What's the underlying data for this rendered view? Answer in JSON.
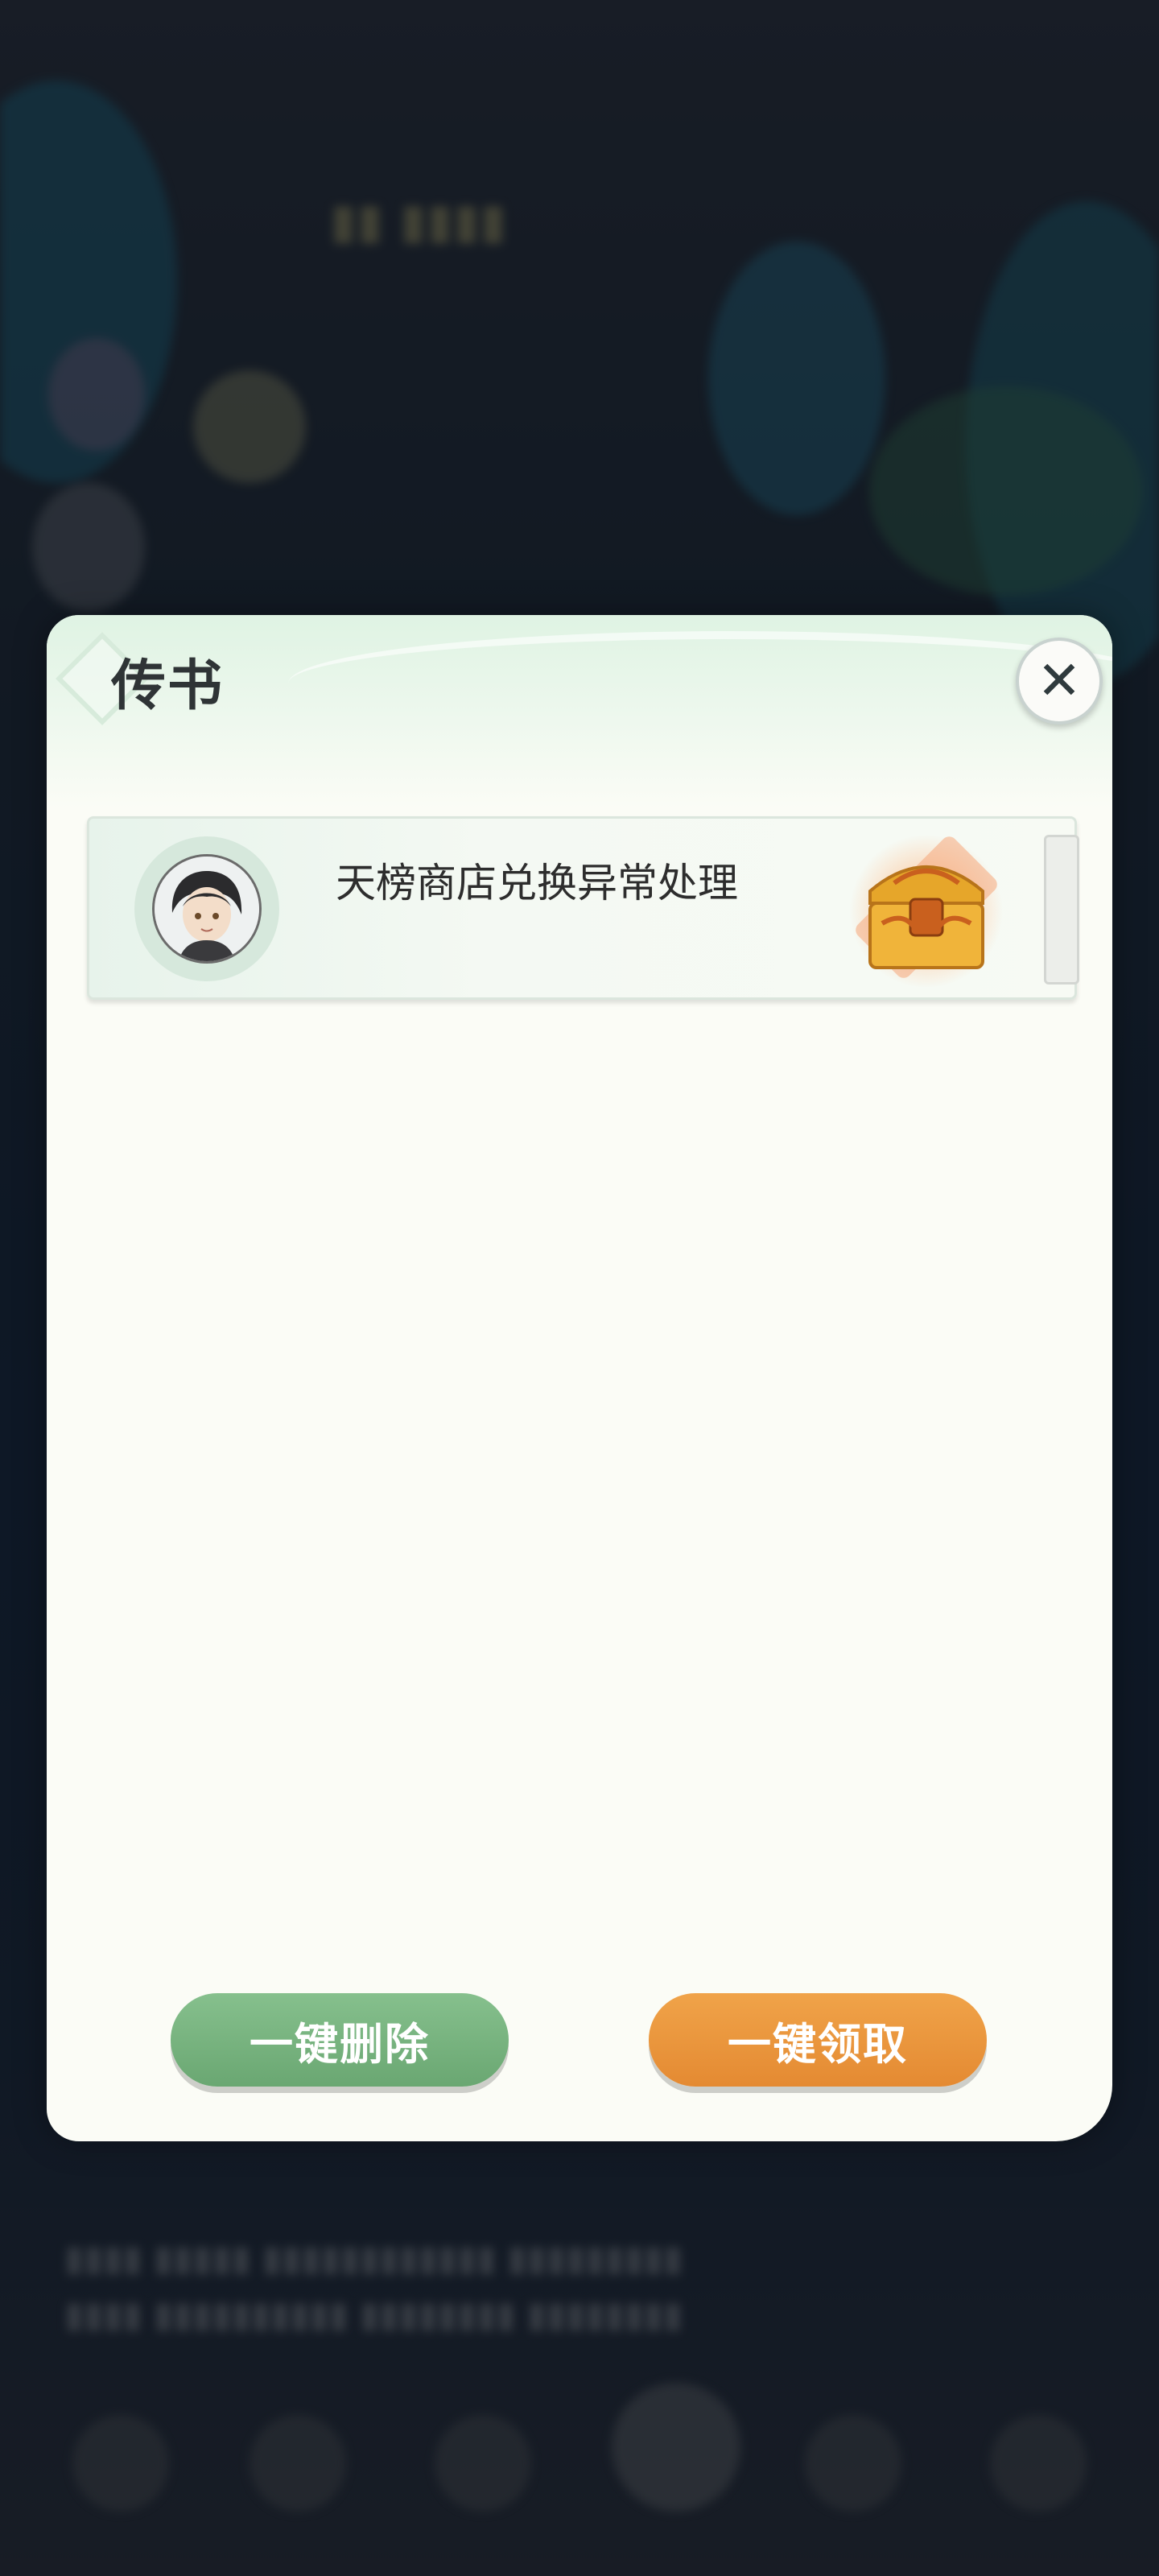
{
  "dialog": {
    "title": "传书",
    "close_label": "✕"
  },
  "mail_list": [
    {
      "subject": "天榜商店兑换异常处理",
      "has_attachment": true
    }
  ],
  "buttons": {
    "delete_all": "一键删除",
    "claim_all": "一键领取"
  },
  "colors": {
    "accent_green": "#6aa772",
    "accent_orange": "#e48a32",
    "panel_bg": "#fbfcf6"
  }
}
